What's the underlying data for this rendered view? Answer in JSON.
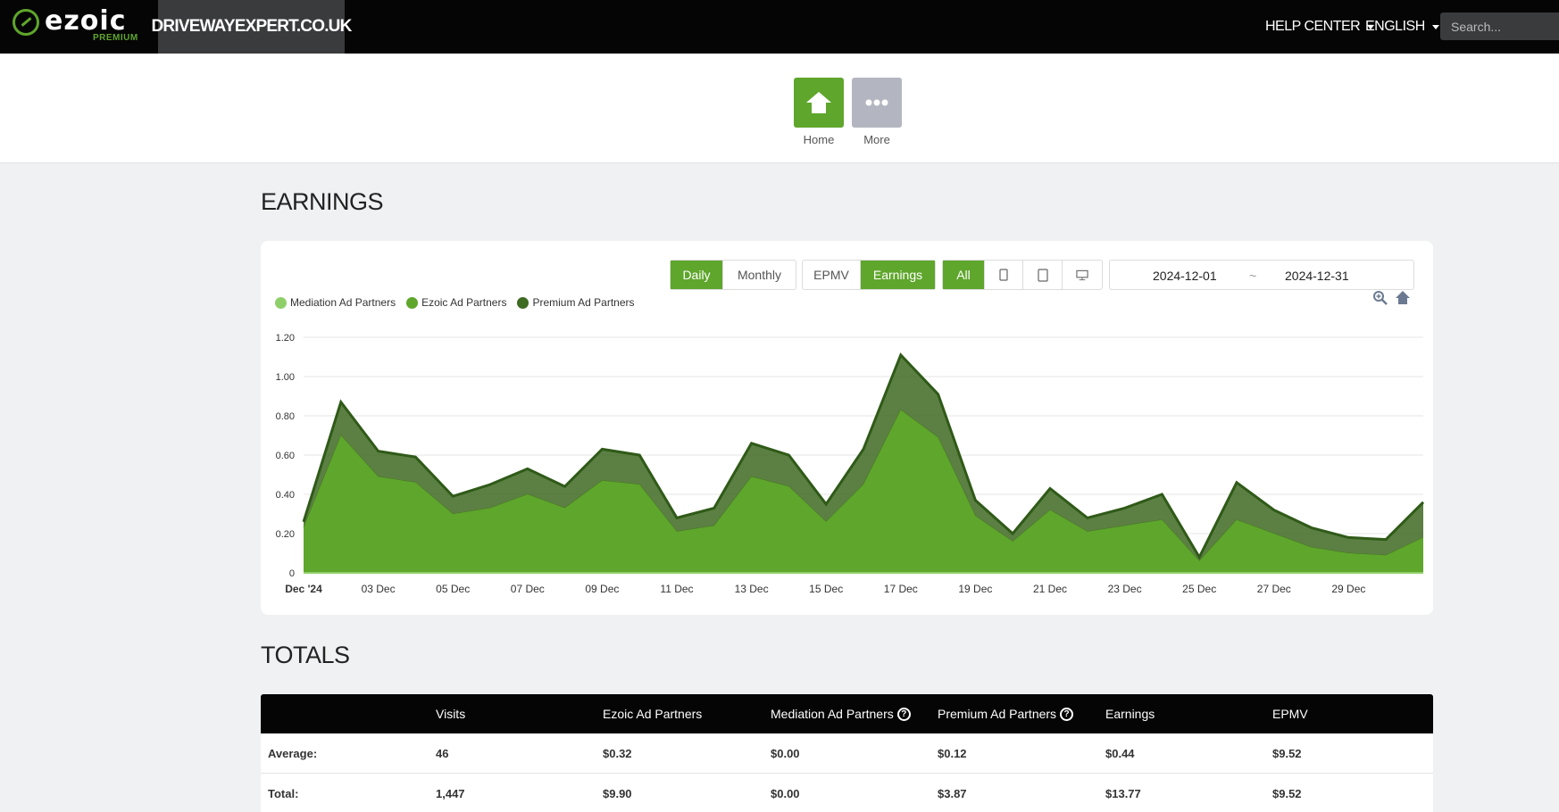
{
  "header": {
    "logo_text": "ezoic",
    "logo_sub": "PREMIUM",
    "site_name": "DRIVEWAYEXPERT.CO.UK",
    "help_center": "HELP CENTER",
    "language": "ENGLISH",
    "search_placeholder": "Search..."
  },
  "quick_links": [
    {
      "label": "Home",
      "icon": "house-icon",
      "color": "#5fa62c"
    },
    {
      "label": "More",
      "icon": "ellipsis-icon",
      "color": "#b3b6c0"
    }
  ],
  "earnings": {
    "title": "EARNINGS",
    "period_options": [
      "Daily",
      "Monthly"
    ],
    "period_selected": "Daily",
    "metric_options": [
      "EPMV",
      "Earnings"
    ],
    "metric_selected": "Earnings",
    "device_options": [
      "All",
      "mobile-icon",
      "tablet-icon",
      "desktop-icon"
    ],
    "device_selected": "All",
    "date_start": "2024-12-01",
    "date_sep": "~",
    "date_end": "2024-12-31"
  },
  "colors": {
    "accent": "#5fa62c",
    "mediation": "#8fcf6a",
    "ezoic": "#5fa62c",
    "premium": "#3f6a22"
  },
  "chart_data": {
    "type": "area",
    "stacked": true,
    "x": [
      "Dec '24",
      "02 Dec",
      "03 Dec",
      "04 Dec",
      "05 Dec",
      "06 Dec",
      "07 Dec",
      "08 Dec",
      "09 Dec",
      "10 Dec",
      "11 Dec",
      "12 Dec",
      "13 Dec",
      "14 Dec",
      "15 Dec",
      "16 Dec",
      "17 Dec",
      "18 Dec",
      "19 Dec",
      "20 Dec",
      "21 Dec",
      "22 Dec",
      "23 Dec",
      "24 Dec",
      "25 Dec",
      "26 Dec",
      "27 Dec",
      "28 Dec",
      "29 Dec",
      "30 Dec",
      "31 Dec"
    ],
    "x_tick_labels": [
      "Dec '24",
      "03 Dec",
      "05 Dec",
      "07 Dec",
      "09 Dec",
      "11 Dec",
      "13 Dec",
      "15 Dec",
      "17 Dec",
      "19 Dec",
      "21 Dec",
      "23 Dec",
      "25 Dec",
      "27 Dec",
      "29 Dec"
    ],
    "y_tick_labels": [
      "0",
      "0.20",
      "0.40",
      "0.60",
      "0.80",
      "1.00",
      "1.20"
    ],
    "ylim": [
      0,
      1.2
    ],
    "grid": true,
    "legend_position": "top-left",
    "series": [
      {
        "name": "Mediation Ad Partners",
        "values": [
          0,
          0,
          0,
          0,
          0,
          0,
          0,
          0,
          0,
          0,
          0,
          0,
          0,
          0,
          0,
          0,
          0,
          0,
          0,
          0,
          0,
          0,
          0,
          0,
          0,
          0,
          0,
          0,
          0,
          0,
          0
        ]
      },
      {
        "name": "Ezoic Ad Partners",
        "values": [
          0.23,
          0.7,
          0.49,
          0.46,
          0.3,
          0.33,
          0.4,
          0.33,
          0.47,
          0.45,
          0.21,
          0.24,
          0.49,
          0.44,
          0.26,
          0.45,
          0.83,
          0.69,
          0.29,
          0.16,
          0.32,
          0.21,
          0.24,
          0.27,
          0.06,
          0.27,
          0.2,
          0.13,
          0.1,
          0.09,
          0.18
        ]
      },
      {
        "name": "Premium Ad Partners",
        "values": [
          0.03,
          0.17,
          0.13,
          0.13,
          0.09,
          0.12,
          0.13,
          0.11,
          0.16,
          0.15,
          0.07,
          0.09,
          0.17,
          0.16,
          0.09,
          0.18,
          0.28,
          0.22,
          0.08,
          0.04,
          0.11,
          0.07,
          0.09,
          0.13,
          0.02,
          0.19,
          0.12,
          0.1,
          0.08,
          0.08,
          0.18
        ]
      }
    ]
  },
  "totals": {
    "title": "TOTALS",
    "columns": [
      "",
      "Visits",
      "Ezoic Ad Partners",
      "Mediation Ad Partners",
      "Premium Ad Partners",
      "Earnings",
      "EPMV"
    ],
    "rows": [
      [
        "Average:",
        "46",
        "$0.32",
        "$0.00",
        "$0.12",
        "$0.44",
        "$9.52"
      ],
      [
        "Total:",
        "1,447",
        "$9.90",
        "$0.00",
        "$3.87",
        "$13.77",
        "$9.52"
      ]
    ]
  }
}
